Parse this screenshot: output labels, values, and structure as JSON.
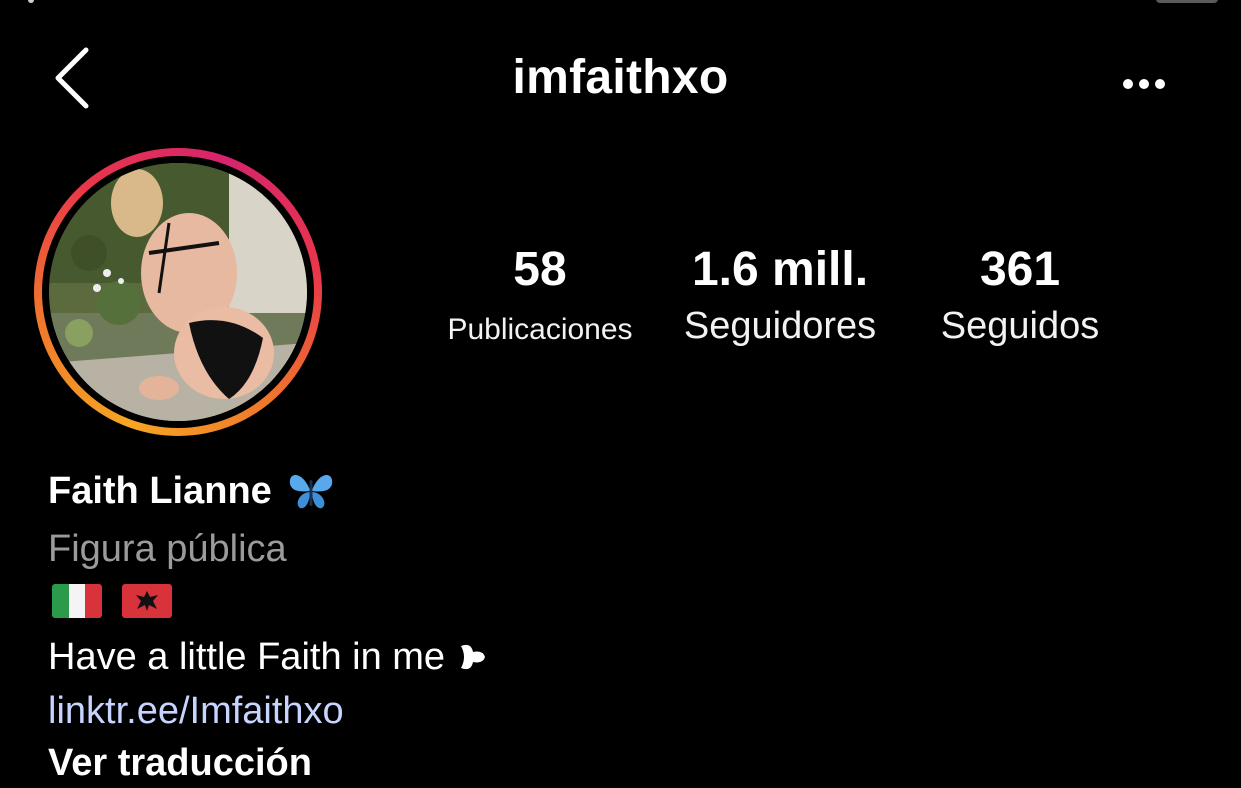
{
  "header": {
    "username": "imfaithxo",
    "back_icon": "chevron-left-icon",
    "more_icon": "ellipsis-icon"
  },
  "avatar": {
    "ring_colors": [
      "#f5a623",
      "#f0762c",
      "#e8364a",
      "#d6246e"
    ]
  },
  "stats": {
    "posts": {
      "value": "58",
      "label": "Publicaciones"
    },
    "followers": {
      "value": "1.6 mill.",
      "label": "Seguidores"
    },
    "following": {
      "value": "361",
      "label": "Seguidos"
    }
  },
  "bio": {
    "full_name": "Faith Lianne",
    "name_emoji": "butterfly-icon",
    "category": "Figura pública",
    "flags": [
      "italy-flag-icon",
      "albania-flag-icon"
    ],
    "text": "Have a little Faith in me",
    "text_emoji": "heart-icon",
    "link": "linktr.ee/Imfaithxo"
  },
  "colors": {
    "background": "#000000",
    "text": "#ffffff",
    "secondary_text": "#9b9b9b",
    "link": "#c7d4ff"
  }
}
